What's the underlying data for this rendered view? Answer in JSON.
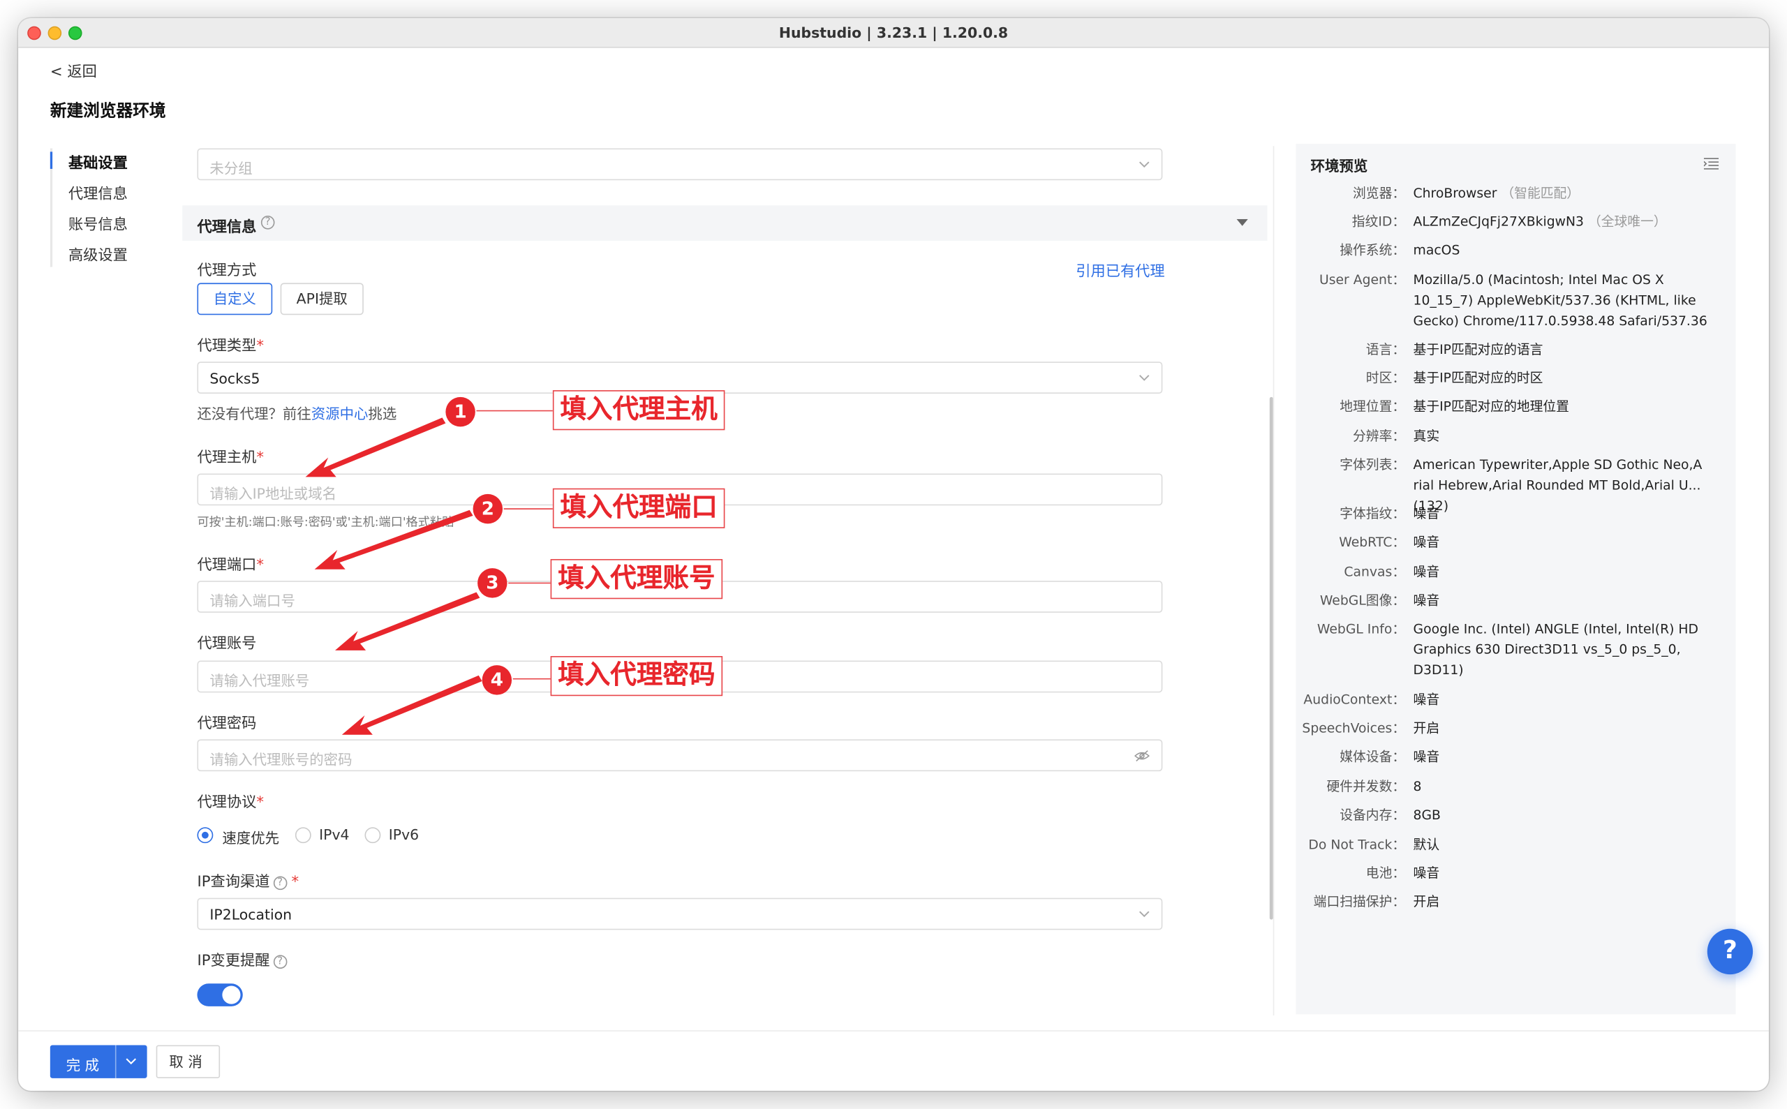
{
  "window": {
    "title": "Hubstudio | 3.23.1 | 1.20.0.8"
  },
  "nav": {
    "back": "< 返回",
    "page_title": "新建浏览器环境",
    "items": [
      "基础设置",
      "代理信息",
      "账号信息",
      "高级设置"
    ]
  },
  "form": {
    "group_placeholder": "未分组",
    "section_title": "代理信息",
    "proxy_mode_label": "代理方式",
    "proxy_mode_options": [
      "自定义",
      "API提取"
    ],
    "use_existing_proxy": "引用已有代理",
    "proxy_type_label": "代理类型",
    "proxy_type_value": "Socks5",
    "no_proxy_hint_prefix": "还没有代理？前往",
    "no_proxy_hint_link": "资源中心",
    "no_proxy_hint_suffix": "挑选",
    "host_label": "代理主机",
    "host_placeholder": "请输入IP地址或域名",
    "host_hint": "可按'主机:端口:账号:密码'或'主机:端口'格式粘贴",
    "port_label": "代理端口",
    "port_placeholder": "请输入端口号",
    "account_label": "代理账号",
    "account_placeholder": "请输入代理账号",
    "password_label": "代理密码",
    "password_placeholder": "请输入代理账号的密码",
    "protocol_label": "代理协议",
    "protocol_options": [
      "速度优先",
      "IPv4",
      "IPv6"
    ],
    "protocol_selected": "速度优先",
    "ip_channel_label": "IP查询渠道",
    "ip_channel_value": "IP2Location",
    "ip_change_label": "IP变更提醒",
    "ip_change_enabled": true
  },
  "preview": {
    "title": "环境预览",
    "rows": [
      {
        "key": "浏览器",
        "value": "ChroBrowser",
        "extra": "（智能匹配）"
      },
      {
        "key": "指纹ID",
        "value": "ALZmZeCJqFj27XBkigwN3",
        "extra": "（全球唯一）"
      },
      {
        "key": "操作系统",
        "value": "macOS"
      },
      {
        "key": "User Agent",
        "value": "Mozilla/5.0 (Macintosh; Intel Mac OS X 10_15_7) AppleWebKit/537.36 (KHTML, like Gecko) Chrome/117.0.5938.48 Safari/537.36"
      },
      {
        "key": "语言",
        "value": "基于IP匹配对应的语言"
      },
      {
        "key": "时区",
        "value": "基于IP匹配对应的时区"
      },
      {
        "key": "地理位置",
        "value": "基于IP匹配对应的地理位置"
      },
      {
        "key": "分辨率",
        "value": "真实"
      },
      {
        "key": "字体列表",
        "value": "American Typewriter,Apple SD Gothic Neo,A rial Hebrew,Arial Rounded MT Bold,Arial U...  (132)"
      },
      {
        "key": "字体指纹",
        "value": "噪音"
      },
      {
        "key": "WebRTC",
        "value": "噪音"
      },
      {
        "key": "Canvas",
        "value": "噪音"
      },
      {
        "key": "WebGL图像",
        "value": "噪音"
      },
      {
        "key": "WebGL Info",
        "value": "Google Inc. (Intel) ANGLE (Intel, Intel(R) HD Graphics 630 Direct3D11 vs_5_0 ps_5_0, D3D11)"
      },
      {
        "key": "AudioContext",
        "value": "噪音"
      },
      {
        "key": "SpeechVoices",
        "value": "开启"
      },
      {
        "key": "媒体设备",
        "value": "噪音"
      },
      {
        "key": "硬件并发数",
        "value": "8"
      },
      {
        "key": "设备内存",
        "value": "8GB"
      },
      {
        "key": "Do Not Track",
        "value": "默认"
      },
      {
        "key": "电池",
        "value": "噪音"
      },
      {
        "key": "端口扫描保护",
        "value": "开启"
      }
    ]
  },
  "footer": {
    "done": "完成",
    "cancel": "取消"
  },
  "help_fab": "?",
  "annotations": [
    {
      "num": "1",
      "text": "填入代理主机"
    },
    {
      "num": "2",
      "text": "填入代理端口"
    },
    {
      "num": "3",
      "text": "填入代理账号"
    },
    {
      "num": "4",
      "text": "填入代理密码"
    }
  ],
  "colors": {
    "accent": "#2f6fe4",
    "annotation": "#e8262c",
    "required": "#e53935"
  }
}
